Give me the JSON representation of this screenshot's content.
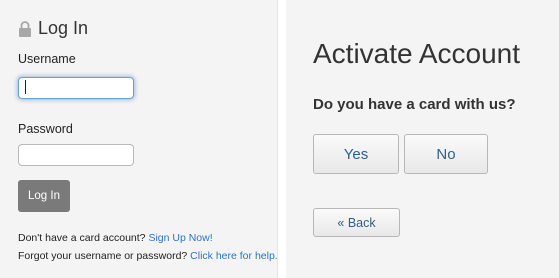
{
  "login": {
    "title": "Log In",
    "icon": "lock-icon",
    "username_label": "Username",
    "username_value": "",
    "password_label": "Password",
    "password_value": "",
    "button_label": "Log In",
    "signup_prompt": "Don't have a card account?",
    "signup_link": "Sign Up Now!",
    "forgot_prompt": "Forgot your username or password?",
    "forgot_link": "Click here for help.",
    "colors": {
      "link": "#2a74c8",
      "button_bg": "#7a7a7a",
      "focus_glow": "#528ad6"
    }
  },
  "activate": {
    "title": "Activate Account",
    "question": "Do you have a card with us?",
    "yes_label": "Yes",
    "no_label": "No",
    "back_label": "« Back",
    "colors": {
      "button_text": "#2f5f8f"
    }
  }
}
